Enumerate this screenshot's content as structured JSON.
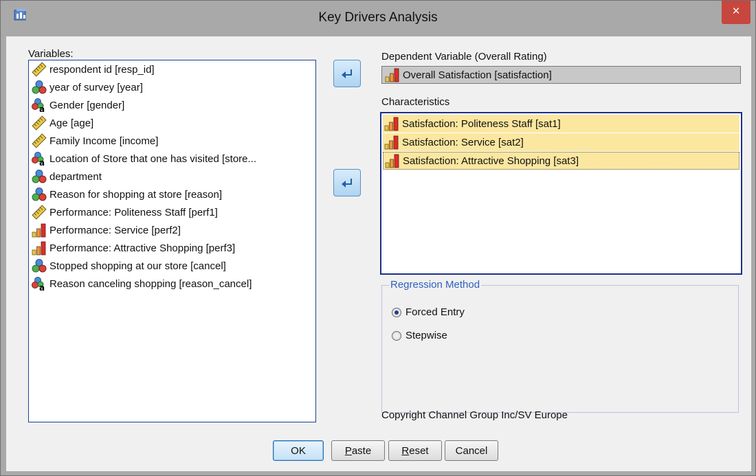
{
  "window": {
    "title": "Key Drivers Analysis",
    "close_label": "×"
  },
  "variables": {
    "label": "Variables:",
    "items": [
      {
        "text": "respondent id [resp_id]",
        "icon": "scale-ruler-icon"
      },
      {
        "text": "year of survey [year]",
        "icon": "nominal-icon"
      },
      {
        "text": "Gender [gender]",
        "icon": "nominal-string-icon"
      },
      {
        "text": "Age [age]",
        "icon": "scale-ruler-icon"
      },
      {
        "text": "Family Income [income]",
        "icon": "scale-ruler-icon"
      },
      {
        "text": "Location of Store that one has visited [store...",
        "icon": "nominal-string-icon"
      },
      {
        "text": "department",
        "icon": "nominal-icon"
      },
      {
        "text": "Reason for shopping at store [reason]",
        "icon": "nominal-icon"
      },
      {
        "text": "Performance: Politeness Staff [perf1]",
        "icon": "scale-ruler-icon"
      },
      {
        "text": "Performance: Service [perf2]",
        "icon": "ordinal-bars-icon"
      },
      {
        "text": "Performance: Attractive Shopping [perf3]",
        "icon": "ordinal-bars-icon"
      },
      {
        "text": "Stopped shopping at our store [cancel]",
        "icon": "nominal-icon"
      },
      {
        "text": "Reason canceling shopping  [reason_cancel]",
        "icon": "nominal-string-icon"
      }
    ]
  },
  "dependent": {
    "label": "Dependent Variable (Overall Rating)",
    "value": "Overall Satisfaction [satisfaction]",
    "icon": "ordinal-bars-icon"
  },
  "characteristics": {
    "label": "Characteristics",
    "items": [
      {
        "text": "Satisfaction:  Politeness Staff [sat1]",
        "icon": "ordinal-bars-icon"
      },
      {
        "text": "Satisfaction: Service [sat2]",
        "icon": "ordinal-bars-icon"
      },
      {
        "text": "Satisfaction:  Attractive Shopping [sat3]",
        "icon": "ordinal-bars-icon"
      }
    ]
  },
  "regression": {
    "label": "Regression Method",
    "options": [
      "Forced Entry",
      "Stepwise"
    ],
    "selected": "Forced Entry"
  },
  "copyright": "Copyright Channel Group Inc/SV Europe",
  "buttons": {
    "ok": "OK",
    "paste_first": "P",
    "paste_rest": "aste",
    "reset_first": "R",
    "reset_rest": "eset",
    "cancel": "Cancel"
  },
  "colors": {
    "selection": "#fbe7a0",
    "list_border": "#1c2f8c",
    "accent": "#2f5fbf",
    "close": "#c7463d"
  }
}
